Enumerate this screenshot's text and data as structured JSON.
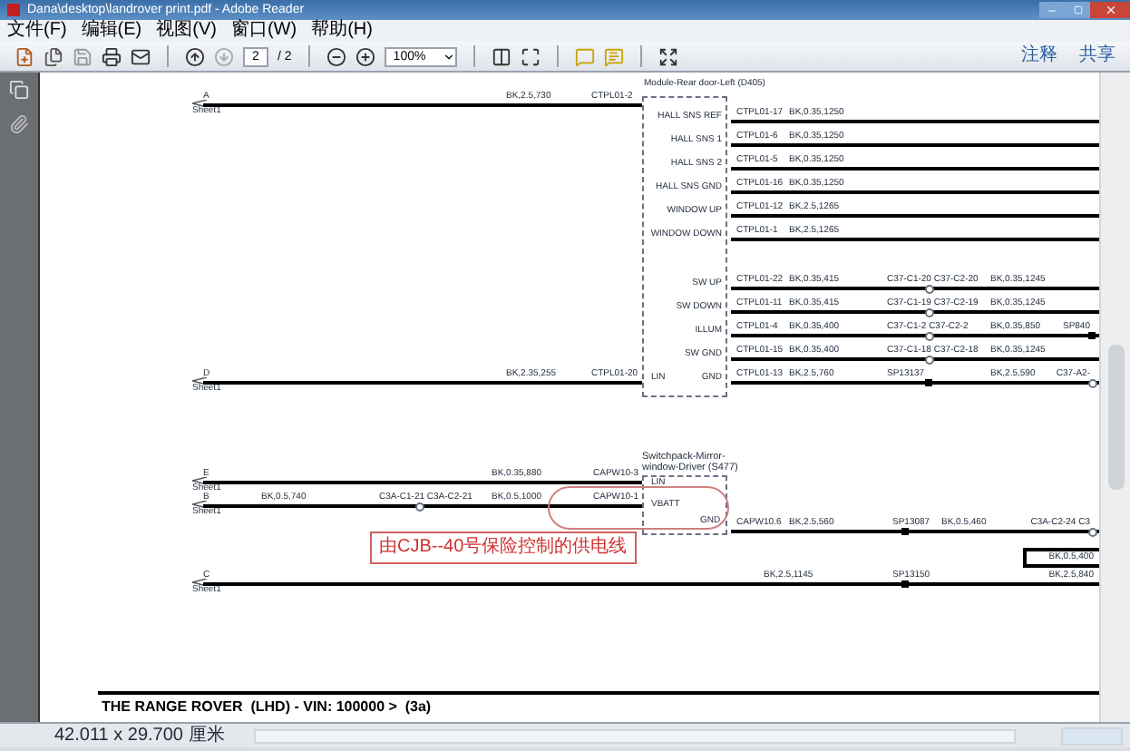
{
  "window": {
    "title": "Dana\\desktop\\landrover print.pdf - Adobe Reader"
  },
  "menu": [
    "文件(F)",
    "编辑(E)",
    "视图(V)",
    "窗口(W)",
    "帮助(H)"
  ],
  "toolbar": {
    "page_field": "2",
    "page_total": "/ 2",
    "zoom": "100%",
    "buttons": [
      "注释",
      "共享"
    ]
  },
  "diagram": {
    "left_wires": [
      {
        "letter": "A",
        "sheet": "Sheet1",
        "wire": "BK,2.5,730",
        "connector": "CTPL01-2"
      },
      {
        "letter": "D",
        "sheet": "Sheet1",
        "wire": "BK,2.35,255",
        "connector": "CTPL01-20"
      }
    ],
    "module": {
      "title": "Module-Rear door-Left (D405)",
      "left_pin": "LIN",
      "pins": [
        "HALL SNS REF",
        "HALL SNS 1",
        "HALL SNS 2",
        "HALL SNS GND",
        "WINDOW UP",
        "WINDOW DOWN",
        "SW UP",
        "SW DOWN",
        "ILLUM",
        "SW GND",
        "GND"
      ]
    },
    "right_wires": [
      {
        "connector": "CTPL01-17",
        "wire": "BK,0.35,1250"
      },
      {
        "connector": "CTPL01-6",
        "wire": "BK,0.35,1250"
      },
      {
        "connector": "CTPL01-5",
        "wire": "BK,0.35,1250"
      },
      {
        "connector": "CTPL01-16",
        "wire": "BK,0.35,1250"
      },
      {
        "connector": "CTPL01-12",
        "wire": "BK,2.5,1265"
      },
      {
        "connector": "CTPL01-1",
        "wire": "BK,2.5,1265"
      },
      {
        "connector": "CTPL01-22",
        "wire": "BK,0.35,415",
        "junction": {
          "label": "C37-C1-20 C37-C2-20",
          "kind": "connector"
        },
        "wire_2": "BK,0.35,1245"
      },
      {
        "connector": "CTPL01-11",
        "wire": "BK,0.35,415",
        "junction": {
          "label": "C37-C1-19 C37-C2-19",
          "kind": "connector"
        },
        "wire_2": "BK,0.35,1245"
      },
      {
        "connector": "CTPL01-4",
        "wire": "BK,0.35,400",
        "junction": {
          "label": "C37-C1-2 C37-C2-2",
          "kind": "connector"
        },
        "wire_2": "BK,0.35,850",
        "end": {
          "label": "SP840",
          "kind": "splice"
        }
      },
      {
        "connector": "CTPL01-15",
        "wire": "BK,0.35,400",
        "junction": {
          "label": "C37-C1-18 C37-C2-18",
          "kind": "connector"
        },
        "wire_2": "BK,0.35,1245"
      },
      {
        "connector": "CTPL01-13",
        "wire": "BK,2.5,760",
        "junction": {
          "label": "SP13137",
          "kind": "splice"
        },
        "wire_2": "BK,2.5,590",
        "end": {
          "label": "C37-A2-",
          "kind": "connector"
        }
      }
    ],
    "lower_left_wires": [
      {
        "letter": "E",
        "sheet": "Sheet1",
        "wire": "BK,0.35,880",
        "connector": "CAPW10-3"
      },
      {
        "letter": "B",
        "sheet": "Sheet1",
        "wire_0": "BK,0.5,740",
        "junction": {
          "label": "C3A-C1-21 C3A-C2-21",
          "kind": "connector"
        },
        "wire": "BK,0.5,1000",
        "connector": "CAPW10-1"
      }
    ],
    "switchpack": {
      "title": "Switchpack-Mirror-window-Driver (S477)",
      "pins": [
        "LIN",
        "VBATT",
        "GND"
      ]
    },
    "gnd_wire": {
      "connector": "CAPW10.6",
      "wire": "BK,2.5,560",
      "junction": {
        "label": "SP13087",
        "kind": "splice"
      },
      "wire_2": "BK,0.5,460",
      "end": {
        "label": "C3A-C2-24 C3",
        "kind": "connector"
      }
    },
    "boxed_label": "BK,0.5,400",
    "wire_c": {
      "letter": "C",
      "sheet": "Sheet1",
      "wire": "BK,2.5,1145",
      "junction": {
        "label": "SP13150",
        "kind": "splice"
      },
      "wire_2": "BK,2.5,840"
    },
    "annotation": "由CJB--40号保险控制的供电线",
    "footer_title": "THE RANGE ROVER  (LHD) - VIN: 100000 >  (3a)"
  },
  "status": {
    "page_size": "42.011 x 29.700 厘米"
  }
}
